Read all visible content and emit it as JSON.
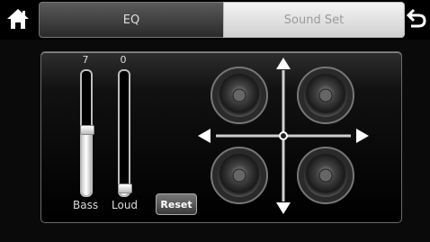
{
  "header": {
    "home_icon": "home-icon",
    "back_icon": "back-arrow-icon",
    "tabs": [
      {
        "label": "EQ",
        "active": true
      },
      {
        "label": "Sound Set",
        "active": false
      }
    ]
  },
  "sliders": [
    {
      "label": "Bass",
      "value": "7",
      "level": 0.52
    },
    {
      "label": "Loud",
      "value": "0",
      "level": 0.05
    }
  ],
  "reset_label": "Reset",
  "balance": {
    "x": 0,
    "y": 0
  },
  "colors": {
    "accent": "#ffffff",
    "background": "#0a0a0a",
    "tab_active": "#3c3c3c",
    "tab_inactive": "#e6e6e6"
  }
}
